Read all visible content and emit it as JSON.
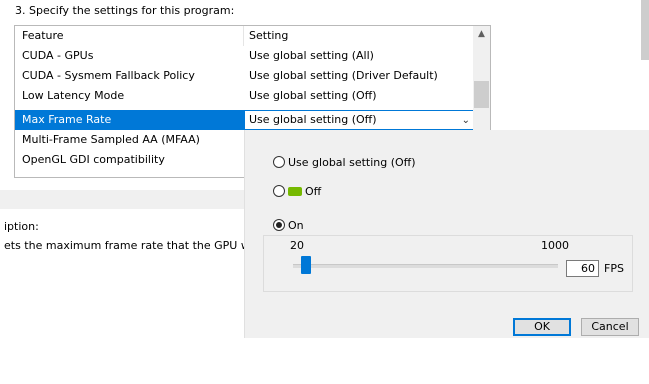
{
  "step_heading": "3. Specify the settings for this program:",
  "table": {
    "headers": {
      "feature": "Feature",
      "setting": "Setting"
    },
    "rows": [
      {
        "feature": "CUDA - GPUs",
        "setting": "Use global setting (All)"
      },
      {
        "feature": "CUDA - Sysmem Fallback Policy",
        "setting": "Use global setting (Driver Default)"
      },
      {
        "feature": "Low Latency Mode",
        "setting": "Use global setting (Off)"
      },
      {
        "feature": "Max Frame Rate",
        "setting": "Use global setting (Off)"
      },
      {
        "feature": "Multi-Frame Sampled AA (MFAA)",
        "setting": ""
      },
      {
        "feature": "OpenGL GDI compatibility",
        "setting": ""
      }
    ],
    "selected_index": 3,
    "scroll_up_icon": "chevron-up-icon",
    "dropdown_icon": "chevron-down-icon"
  },
  "description": {
    "label": "iption:",
    "text": "ets the maximum frame rate that the GPU will rend"
  },
  "popup": {
    "options": [
      {
        "label": "Use global setting (Off)",
        "checked": false
      },
      {
        "label": "Off",
        "checked": false,
        "icon": "nvidia-icon"
      },
      {
        "label": "On",
        "checked": true
      }
    ],
    "slider": {
      "min_label": "20",
      "max_label": "1000",
      "value": 60,
      "unit": "FPS"
    },
    "ok_label": "OK",
    "cancel_label": "Cancel",
    "accent_color": "#0078d7",
    "nvidia_color": "#76b900"
  }
}
